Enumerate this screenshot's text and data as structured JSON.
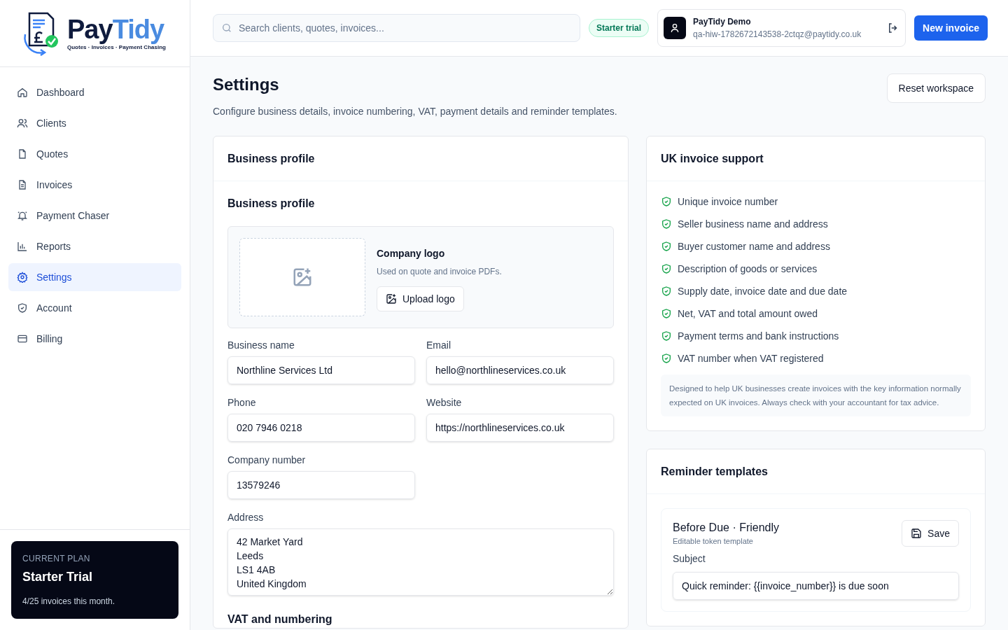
{
  "brand": {
    "parts": [
      {
        "text": "Pay",
        "color": "#0f1b3d"
      },
      {
        "text": "Tidy",
        "color": "#4a8be0"
      }
    ],
    "tagline": "Quotes · Invoices · Payment Chasing"
  },
  "sidebar": {
    "items": [
      {
        "label": "Dashboard",
        "selected": false
      },
      {
        "label": "Clients",
        "selected": false
      },
      {
        "label": "Quotes",
        "selected": false
      },
      {
        "label": "Invoices",
        "selected": false
      },
      {
        "label": "Payment Chaser",
        "selected": false
      },
      {
        "label": "Reports",
        "selected": false
      },
      {
        "label": "Settings",
        "selected": true
      },
      {
        "label": "Account",
        "selected": false
      },
      {
        "label": "Billing",
        "selected": false
      }
    ],
    "plan": {
      "eyebrow": "CURRENT PLAN",
      "name": "Starter Trial",
      "usage": "4/25 invoices this month."
    }
  },
  "header": {
    "search": {
      "placeholder": "Search clients, quotes, invoices..."
    },
    "badge": "Starter trial",
    "user": {
      "name": "PayTidy Demo",
      "email": "qa-hiw-1782672143538-2ctqz@paytidy.co.uk"
    },
    "primary_button": "New invoice"
  },
  "page": {
    "title": "Settings",
    "subtitle": "Configure business details, invoice numbering, VAT, payment details and reminder templates.",
    "reset_button": "Reset workspace"
  },
  "business_profile": {
    "card_title": "Business profile",
    "section_title": "Business profile",
    "logo": {
      "title": "Company logo",
      "hint": "Used on quote and invoice PDFs.",
      "button": "Upload logo"
    },
    "fields": [
      {
        "label": "Business name",
        "value": "Northline Services Ltd",
        "kind": "text"
      },
      {
        "label": "Email",
        "value": "hello@northlineservices.co.uk",
        "kind": "text"
      },
      {
        "label": "Phone",
        "value": "020 7946 0218",
        "kind": "text"
      },
      {
        "label": "Website",
        "value": "https://northlineservices.co.uk",
        "kind": "text"
      },
      {
        "label": "Company number",
        "value": "13579246",
        "kind": "text"
      },
      {
        "label": "Address",
        "value": "42 Market Yard\nLeeds\nLS1 4AB\nUnited Kingdom",
        "kind": "textarea"
      }
    ],
    "next_section_title": "VAT and numbering"
  },
  "uk_support": {
    "title": "UK invoice support",
    "items": [
      "Unique invoice number",
      "Seller business name and address",
      "Buyer customer name and address",
      "Description of goods or services",
      "Supply date, invoice date and due date",
      "Net, VAT and total amount owed",
      "Payment terms and bank instructions",
      "VAT number when VAT registered"
    ],
    "note": "Designed to help UK businesses create invoices with the key information normally expected on UK invoices. Always check with your accountant for tax advice."
  },
  "reminders": {
    "title": "Reminder templates",
    "template": {
      "title": "Before Due · Friendly",
      "subtitle": "Editable token template",
      "save_button": "Save",
      "subject_label": "Subject",
      "subject_value": "Quick reminder: {{invoice_number}} is due soon"
    }
  }
}
